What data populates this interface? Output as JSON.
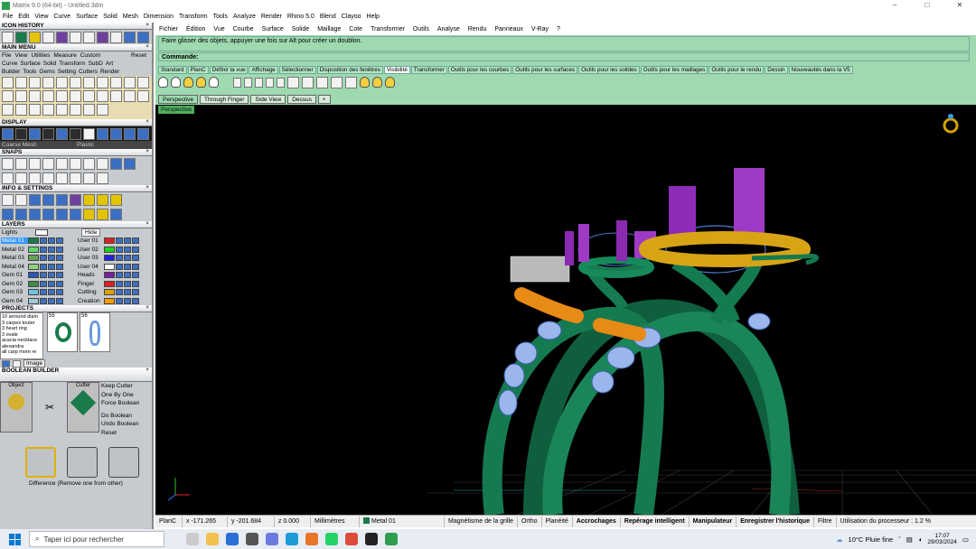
{
  "window": {
    "title": "Matrix 9.0 (64-bit) - Untitled.3dm",
    "controls": [
      "–",
      "□",
      "✕"
    ]
  },
  "menubar": [
    "File",
    "Edit",
    "View",
    "Curve",
    "Surface",
    "Solid",
    "Mesh",
    "Dimension",
    "Transform",
    "Tools",
    "Analyze",
    "Render",
    "Rhino 5.0",
    "Blend",
    "Clayoo",
    "Help"
  ],
  "left": {
    "icon_history": "ICON HISTORY",
    "main_menu": "MAIN MENU",
    "main_menu_tabs": [
      "File",
      "View",
      "Utilities",
      "Measure",
      "Custom"
    ],
    "main_menu_reset": "Reset",
    "main_menu_row1": [
      "Curve",
      "Surface",
      "Solid",
      "Transform",
      "SubD",
      "Art"
    ],
    "main_menu_row2": [
      "Builder",
      "Tools",
      "Gems",
      "Setting",
      "Cutters",
      "Render"
    ],
    "display": "DISPLAY",
    "display_fields": [
      "Coarse Mesh",
      "Plastic"
    ],
    "snaps": "SNAPS",
    "info_settings": "INFO & SETTINGS",
    "layers": "LAYERS",
    "lights_label": "Lights",
    "hide_label": "Hide",
    "layers_left": [
      {
        "name": "Metal 01",
        "color": "#1a7a4a"
      },
      {
        "name": "Metal 02",
        "color": "#5fd66a"
      },
      {
        "name": "Metal 03",
        "color": "#63a355"
      },
      {
        "name": "Metal 04",
        "color": "#8fd17f"
      },
      {
        "name": "Gem 01",
        "color": "#2b58b8"
      },
      {
        "name": "Gem 02",
        "color": "#3e8a49"
      },
      {
        "name": "Gem 03",
        "color": "#6ec3e0"
      },
      {
        "name": "Gem 04",
        "color": "#a5c8d8"
      }
    ],
    "layers_right": [
      {
        "name": "User 01",
        "color": "#e02020"
      },
      {
        "name": "User 02",
        "color": "#20d020"
      },
      {
        "name": "User 03",
        "color": "#2020e0"
      },
      {
        "name": "User 04",
        "color": "#ffffff"
      },
      {
        "name": "Heads",
        "color": "#7a1fa0"
      },
      {
        "name": "Finger",
        "color": "#e02020"
      },
      {
        "name": "Cutting",
        "color": "#e0a000"
      },
      {
        "name": "Creation",
        "color": "#ff9a00"
      }
    ],
    "projects": "PROJECTS",
    "project_list": [
      "10 arround diam",
      "3 carpes touter",
      "3 heart ring",
      "3 ovale",
      "acacia necklace",
      "alexandra",
      "all carp more re"
    ],
    "project_thumbs": [
      "55",
      "56"
    ],
    "project_image_label": "Image",
    "boolean_builder": "BOOLEAN BUILDER",
    "bool_object": "Object",
    "bool_cutter": "Cutter",
    "bool_options": [
      "Keep Cutter",
      "One By One",
      "Force Boolean"
    ],
    "bool_actions": [
      "Do Boolean",
      "Undo Boolean",
      "Reset"
    ],
    "bool_caption": "Difference (Remove one from other)"
  },
  "top": {
    "menu": [
      "Fichier",
      "Édition",
      "Vue",
      "Courbe",
      "Surface",
      "Solide",
      "Maillage",
      "Cote",
      "Transformer",
      "Outils",
      "Analyse",
      "Rendu",
      "Panneaux",
      "V-Ray",
      "?"
    ],
    "history_text": "Faire glisser des objets, appuyer une fois sur Alt pour créer un doublon.",
    "command_label": "Commande:",
    "tabs": [
      "Standard",
      "PlanC",
      "Définir la vue",
      "Affichage",
      "Sélectionner",
      "Disposition des fenêtres",
      "Visibilité",
      "Transformer",
      "Outils pour les courbes",
      "Outils pour les surfaces",
      "Outils pour les solides",
      "Outils pour les maillages",
      "Outils pour le rendu",
      "Dessin",
      "Nouveautés dans la V5"
    ],
    "active_tab": "Visibilité",
    "viewport_tabs": [
      "Perspective",
      "Through Finger",
      "Side View",
      "Dessus",
      "+"
    ]
  },
  "viewport": {
    "label": "Perspective"
  },
  "status": {
    "plane": "PlanC",
    "x": "x -171.265",
    "y": "y -201.684",
    "z": "z 0.000",
    "units": "Millimètres",
    "layer": "Metal 01",
    "toggles": [
      "Magnétisme de la grille",
      "Ortho",
      "Planéité",
      "Accrochages",
      "Repérage intelligent",
      "Manipulateur",
      "Enregistrer l'historique",
      "Filtre"
    ],
    "cpu": "Utilisation du processeur : 1.2 %"
  },
  "taskbar": {
    "search_placeholder": "Taper ici pour rechercher",
    "weather": "10°C  Pluie fine",
    "time": "17:07",
    "date": "29/03/2024"
  }
}
